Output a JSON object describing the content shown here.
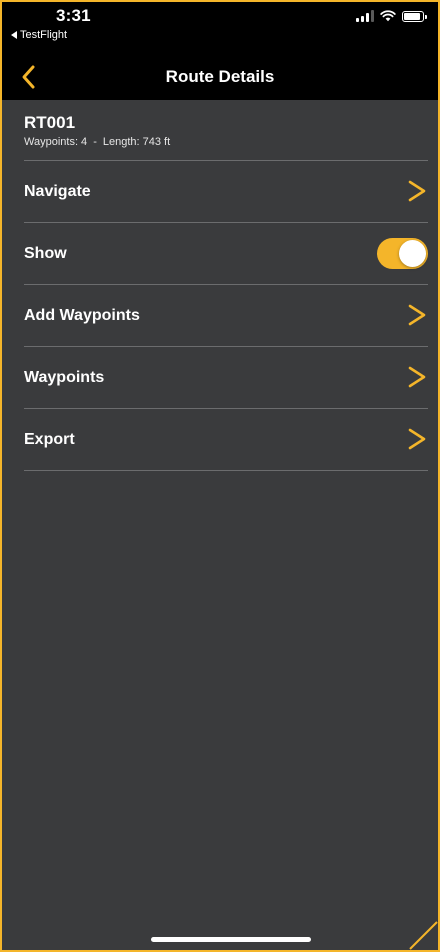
{
  "status_bar": {
    "time": "3:31",
    "back_app": "TestFlight"
  },
  "nav": {
    "title": "Route Details"
  },
  "route": {
    "name": "RT001",
    "waypoints_text": "Waypoints: 4",
    "separator": "-",
    "length_text": "Length: 743 ft"
  },
  "menu": {
    "navigate": "Navigate",
    "show": "Show",
    "show_toggle_on": true,
    "add_waypoints": "Add Waypoints",
    "waypoints": "Waypoints",
    "export": "Export"
  },
  "colors": {
    "accent": "#f4b52a",
    "background": "#3a3b3d",
    "chrome": "#000000"
  },
  "icons": {
    "back": "chevron-left-icon",
    "row_arrow": "chevron-right-icon",
    "signal": "cellular-signal-icon",
    "wifi": "wifi-icon",
    "battery": "battery-icon"
  }
}
